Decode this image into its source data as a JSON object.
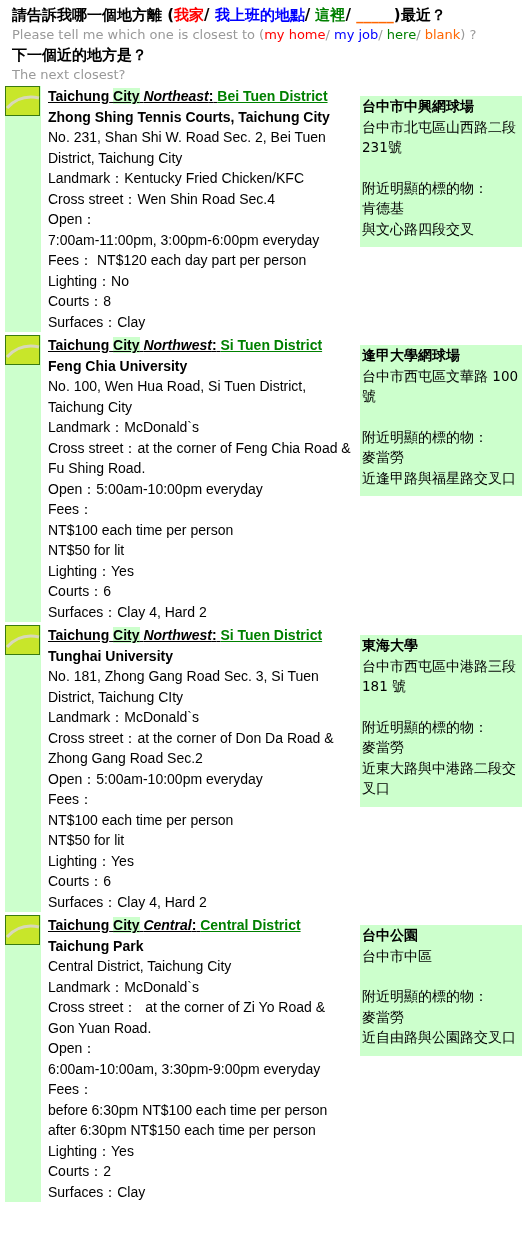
{
  "question_zh": {
    "prefix": "請告訴我哪一個地方離 (",
    "options": [
      {
        "text": "我家",
        "color": "#ff0000",
        "sep": "/"
      },
      {
        "text": "我上班的地點",
        "color": "#0000ff",
        "sep": "/"
      },
      {
        "text": "這裡",
        "color": "#008000",
        "sep": "/"
      },
      {
        "text": "_____",
        "color": "#ff6600"
      }
    ],
    "suffix": ")最近？"
  },
  "question_en": {
    "prefix": "Please tell me which one is closest to (",
    "options": [
      {
        "text": "my home",
        "color": "#ff0000",
        "sep": "/"
      },
      {
        "text": "my job",
        "color": "#0000ff",
        "sep": "/"
      },
      {
        "text": "here",
        "color": "#008000",
        "sep": "/"
      },
      {
        "text": "blank",
        "color": "#ff6600"
      }
    ],
    "suffix": ") ?"
  },
  "next_zh": "下一個近的地方是？",
  "next_en": "The next closest?",
  "places": [
    {
      "city": "Taichung",
      "city_highlight": "City",
      "region": "Northeast",
      "colon": ":",
      "district": "Bei Tuen District",
      "name": "Zhong Shing Tennis Courts, Taichung City",
      "lines": [
        "No. 231, Shan Shi W. Road Sec. 2, Bei Tuen District, Taichung City",
        "Landmark：Kentucky Fried Chicken/KFC",
        "Cross street：Wen Shin Road Sec.4",
        "Open：",
        "7:00am-11:00pm, 3:00pm-6:00pm everyday",
        "Fees： NT$120 each day part per person",
        "Lighting：No",
        "Courts：8",
        "Surfaces：Clay"
      ],
      "zh_name": "台中市中興網球場",
      "zh_address": "台中市北屯區山西路二段 231號",
      "zh_lines": [
        "附近明顯的標的物：",
        "肯德基",
        "與文心路四段交叉"
      ]
    },
    {
      "city": "Taichung",
      "city_highlight": "City",
      "region": "Northwest",
      "colon": ":",
      "district": "Si Tuen District",
      "name": "Feng Chia University",
      "lines": [
        "No. 100, Wen Hua Road, Si Tuen District, Taichung City",
        "Landmark：McDonald`s",
        "Cross street：at the corner of Feng Chia Road & Fu Shing Road.",
        "Open：5:00am-10:00pm everyday",
        "Fees：",
        "NT$100 each time per person",
        "NT$50 for lit",
        "Lighting：Yes",
        "Courts：6",
        "Surfaces：Clay 4, Hard 2"
      ],
      "zh_name": "逢甲大學網球場",
      "zh_address": "台中市西屯區文華路 100號",
      "zh_lines": [
        "附近明顯的標的物：",
        "麥當勞",
        "近逢甲路與福星路交叉口"
      ]
    },
    {
      "city": "Taichung",
      "city_highlight": "City",
      "region": "Northwest",
      "colon": ":",
      "district": "Si Tuen District",
      "name": "Tunghai University",
      "lines": [
        "No. 181, Zhong Gang Road Sec. 3, Si Tuen District, Taichung CIty",
        "Landmark：McDonald`s",
        "Cross street：at the corner of Don Da Road & Zhong Gang Road Sec.2",
        "Open：5:00am-10:00pm everyday",
        "Fees：",
        "NT$100 each time per person",
        "NT$50 for lit",
        "Lighting：Yes",
        "Courts：6",
        "Surfaces：Clay 4, Hard 2"
      ],
      "zh_name": "東海大學",
      "zh_address": "台中市西屯區中港路三段 181 號",
      "zh_lines": [
        "附近明顯的標的物：",
        "麥當勞",
        "近東大路與中港路二段交叉口"
      ]
    },
    {
      "city": "Taichung",
      "city_highlight": "City",
      "region": "Central",
      "colon": ":",
      "district": "Central District",
      "name": "Taichung Park",
      "lines": [
        "Central District, Taichung City",
        "Landmark：McDonald`s",
        "Cross street：  at the corner of Zi Yo Road & Gon Yuan Road.",
        "Open：",
        "6:00am-10:00am, 3:30pm-9:00pm everyday",
        "Fees：",
        "before 6:30pm NT$100 each time per person",
        "after 6:30pm NT$150 each time per person",
        "Lighting：Yes",
        "Courts：2",
        "Surfaces：Clay"
      ],
      "zh_name": "台中公園",
      "zh_address": "台中市中區",
      "zh_lines": [
        "附近明顯的標的物：",
        "麥當勞",
        "近自由路與公園路交叉口"
      ]
    }
  ]
}
